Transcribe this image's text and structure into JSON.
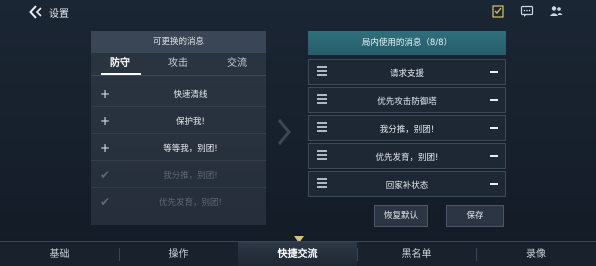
{
  "header": {
    "title": "设置",
    "icons": [
      "back-icon",
      "checklist-icon",
      "chat-icon",
      "friends-icon"
    ]
  },
  "available": {
    "title": "可更换的消息",
    "tabs": [
      "防守",
      "攻击",
      "交流"
    ],
    "active_tab": "防守",
    "items": [
      {
        "text": "快速清线",
        "mark": "+",
        "state": "available"
      },
      {
        "text": "保护我!",
        "mark": "+",
        "state": "available"
      },
      {
        "text": "等等我，别团!",
        "mark": "+",
        "state": "available"
      },
      {
        "text": "我分推，别团!",
        "mark": "✔",
        "state": "selected"
      },
      {
        "text": "优先发育，别团!",
        "mark": "✔",
        "state": "selected"
      }
    ]
  },
  "selected": {
    "title": "局内使用的消息（8/8）",
    "items": [
      {
        "text": "请求支援"
      },
      {
        "text": "优先攻击防御塔"
      },
      {
        "text": "我分推，别团!"
      },
      {
        "text": "优先发育，别团!"
      },
      {
        "text": "回家补状态"
      }
    ]
  },
  "buttons": {
    "reset": "恢复默认",
    "save": "保存"
  },
  "nav": {
    "items": [
      "基础",
      "操作",
      "快捷交流",
      "黑名单",
      "录像"
    ],
    "active": "快捷交流"
  },
  "colors": {
    "background": "#161f2b",
    "panel": "#2b3542",
    "accent_header": "#2f6f7d",
    "text": "#e8ecf1",
    "disabled_text": "#5d6775"
  }
}
